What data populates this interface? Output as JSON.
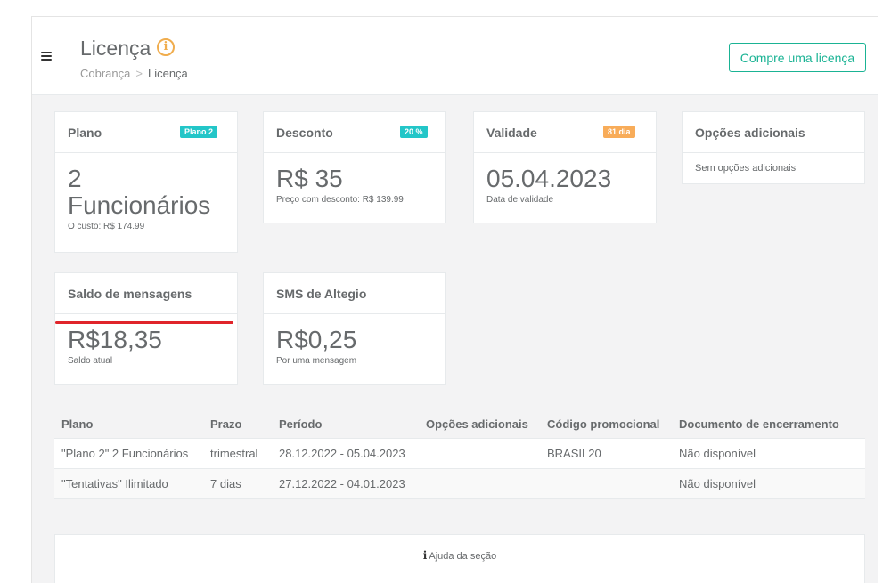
{
  "header": {
    "title": "Licença",
    "breadcrumb": {
      "parent": "Cobrança",
      "separator": ">",
      "current": "Licença"
    },
    "buy_button": "Compre uma licença"
  },
  "cards": {
    "plan": {
      "title": "Plano",
      "badge": "Plano 2",
      "value_line1": "2",
      "value_line2": "Funcionários",
      "note": "O custo: R$ 174.99"
    },
    "discount": {
      "title": "Desconto",
      "badge": "20 %",
      "value": "R$ 35",
      "note": "Preço com desconto: R$ 139.99"
    },
    "validity": {
      "title": "Validade",
      "badge": "81 dia",
      "value": "05.04.2023",
      "note": "Data de validade"
    },
    "extras": {
      "title": "Opções adicionais",
      "text": "Sem opções adicionais"
    },
    "balance": {
      "title": "Saldo de mensagens",
      "value": "R$18,35",
      "note": "Saldo atual"
    },
    "sms": {
      "title": "SMS de Altegio",
      "value": "R$0,25",
      "note": "Por uma mensagem"
    }
  },
  "table": {
    "headers": {
      "plan": "Plano",
      "term": "Prazo",
      "period": "Período",
      "extras": "Opções adicionais",
      "promo": "Código promocional",
      "doc": "Documento de encerramento"
    },
    "rows": [
      {
        "plan": "\"Plano 2\" 2 Funcionários",
        "term": "trimestral",
        "period": "28.12.2022 - 05.04.2023",
        "extras": "",
        "promo": "BRASIL20",
        "doc": "Não disponível"
      },
      {
        "plan": "\"Tentativas\" Ilimitado",
        "term": "7 dias",
        "period": "27.12.2022 - 04.01.2023",
        "extras": "",
        "promo": "",
        "doc": "Não disponível"
      }
    ]
  },
  "help": {
    "label": "Ajuda da seção"
  },
  "colors": {
    "accent": "#1ab394",
    "badge_teal": "#23c6c8",
    "badge_orange": "#f8ac59",
    "info": "#f0ad4e",
    "highlight": "#e0242a"
  }
}
